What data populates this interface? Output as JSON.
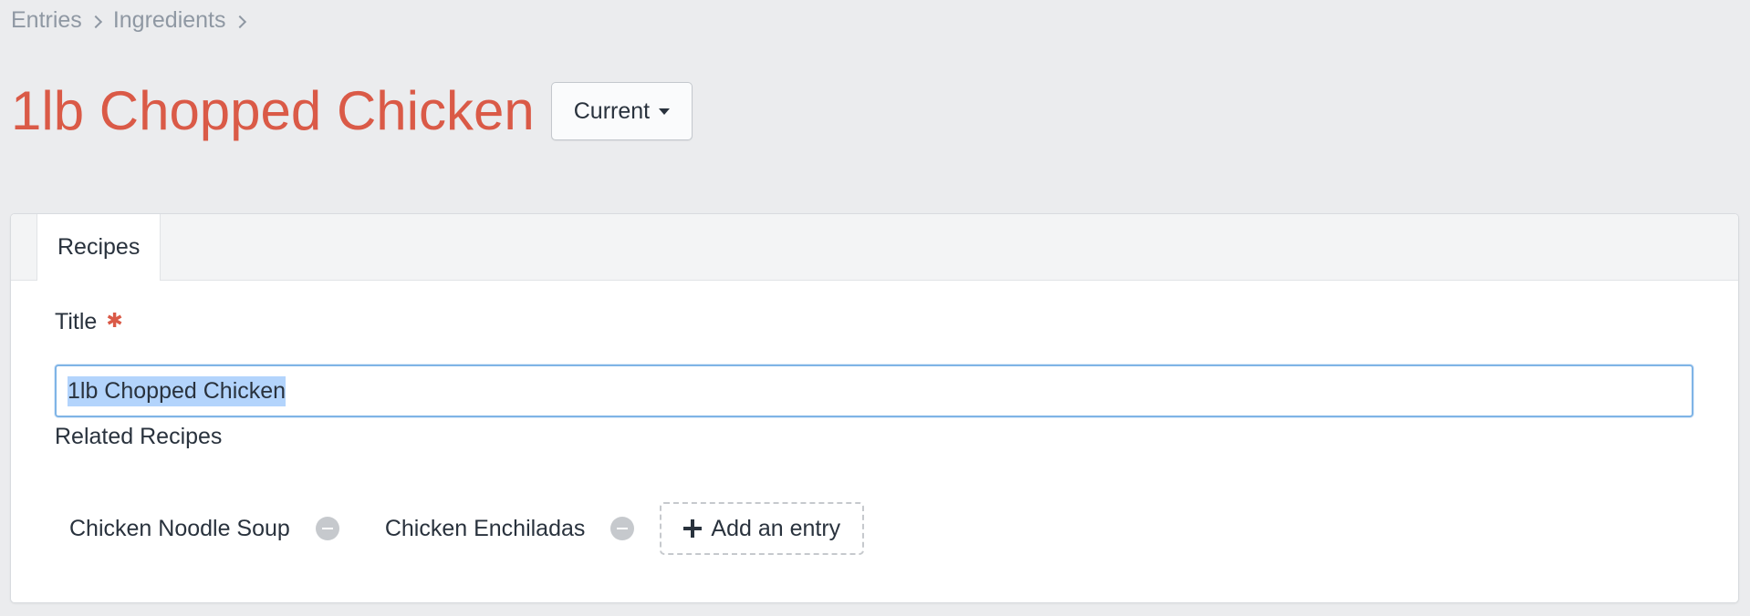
{
  "breadcrumb": {
    "items": [
      {
        "label": "Entries"
      },
      {
        "label": "Ingredients"
      }
    ]
  },
  "header": {
    "title": "1lb Chopped Chicken",
    "status_label": "Current",
    "title_color": "#da5a47"
  },
  "tabs": [
    {
      "label": "Recipes",
      "active": true
    }
  ],
  "fields": {
    "title": {
      "label": "Title",
      "required_marker": "✱",
      "value": "1lb Chopped Chicken"
    },
    "related_recipes": {
      "label": "Related Recipes",
      "items": [
        {
          "label": "Chicken Noodle Soup"
        },
        {
          "label": "Chicken Enchiladas"
        }
      ],
      "add_label": "Add an entry"
    }
  },
  "icons": {
    "breadcrumb_separator": "chevron-right-icon",
    "status_caret": "caret-down-icon",
    "remove": "minus-circle-icon",
    "add": "plus-icon"
  }
}
